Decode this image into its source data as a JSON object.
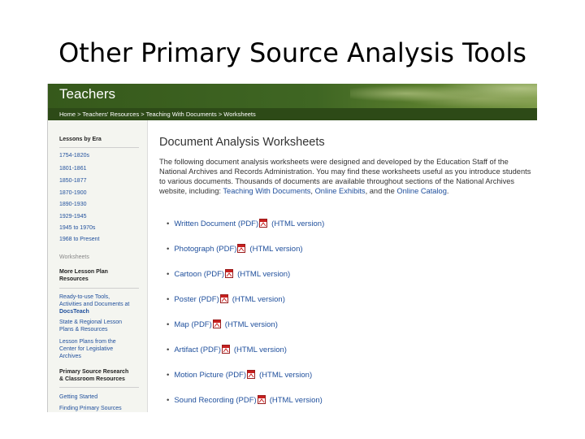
{
  "slide_title": "Other Primary Source Analysis Tools",
  "site": {
    "section_title": "Teachers",
    "breadcrumb": "Home > Teachers' Resources > Teaching With Documents >  Worksheets"
  },
  "sidebar": {
    "lessons_heading": "Lessons by Era",
    "eras": [
      "1754-1820s",
      "1801-1861",
      "1850-1877",
      "1870-1900",
      "1890-1930",
      "1929-1945",
      "1945 to 1970s",
      "1968 to Present"
    ],
    "worksheets_label": "Worksheets",
    "more_heading_line1": "More Lesson Plan",
    "more_heading_line2": "Resources",
    "ready_line1": "Ready-to-use Tools,",
    "ready_line2": "Activities and Documents at",
    "ready_line3": "DocsTeach",
    "state_line1": "State & Regional Lesson",
    "state_line2": "Plans & Resources",
    "center_line1": "Lesson Plans from the",
    "center_line2": "Center for Legislative",
    "center_line3": "Archives",
    "psr_line1": "Primary Source Research",
    "psr_line2": "& Classroom Resources",
    "getting_started": "Getting Started",
    "finding": "Finding Primary Sources"
  },
  "main": {
    "heading": "Document Analysis Worksheets",
    "intro_text": "The following document analysis worksheets were designed and developed by the Education Staff of the National Archives and Records Administration. You may find these worksheets useful as you introduce students to various documents. Thousands of documents are available throughout sections of the National Archives website, including: ",
    "link_twd": "Teaching With Documents",
    "sep1": ", ",
    "link_exhibits": "Online Exhibits",
    "sep2": ", and the ",
    "link_catalog": "Online Catalog",
    "end": ".",
    "html_label": "(HTML version)",
    "worksheets": [
      "Written Document (PDF)",
      "Photograph (PDF)",
      "Cartoon (PDF)",
      "Poster (PDF)",
      "Map (PDF)",
      "Artifact (PDF)",
      "Motion Picture (PDF)",
      "Sound Recording (PDF)"
    ]
  }
}
